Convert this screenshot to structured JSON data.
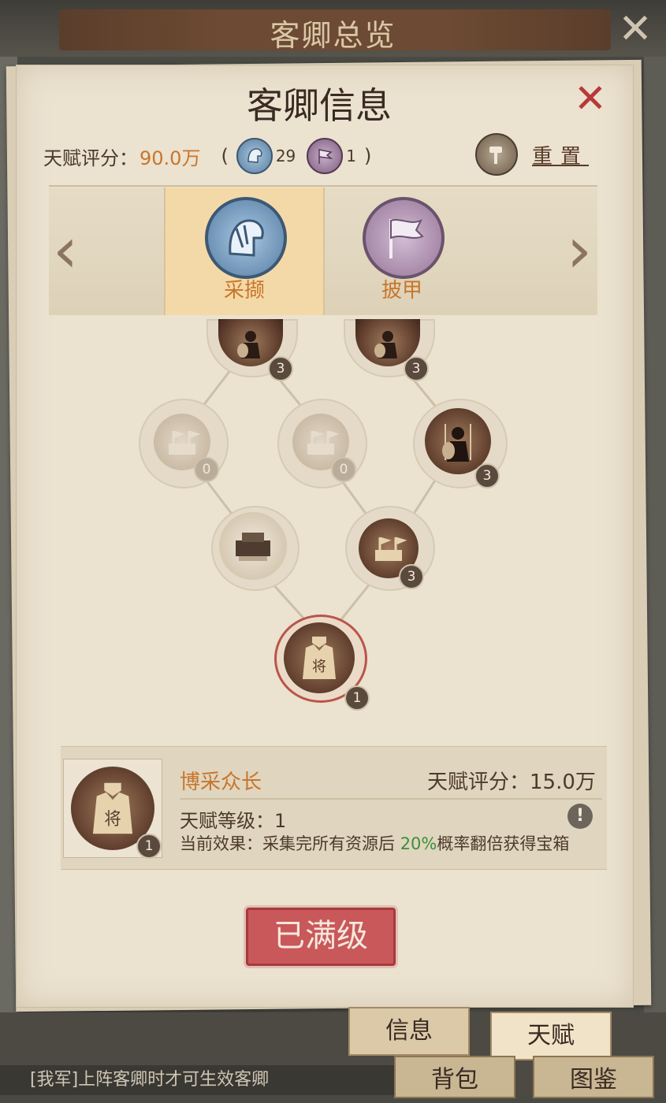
{
  "header": {
    "title": "客卿总览",
    "close_icon": "close-icon"
  },
  "panel": {
    "title": "客卿信息",
    "close_icon": "red-close-icon"
  },
  "summary": {
    "score_label": "天赋评分：",
    "score_value": "90.0万",
    "open_paren": "(",
    "close_paren": ")",
    "blue_count": "29",
    "purple_count": "1",
    "reset_label": "重置"
  },
  "categories": [
    {
      "label": "采撷",
      "icon": "helmet-icon",
      "active": true
    },
    {
      "label": "披甲",
      "icon": "flag-icon",
      "active": false
    }
  ],
  "tree": {
    "nodes": [
      {
        "icon": "soldiers-icon",
        "level": "3"
      },
      {
        "icon": "soldiers-icon",
        "level": "3"
      },
      {
        "icon": "flag-city-icon",
        "level": "0"
      },
      {
        "icon": "flag-city-icon",
        "level": "0"
      },
      {
        "icon": "soldiers-icon",
        "level": "3"
      },
      {
        "icon": "cart-icon",
        "level": ""
      },
      {
        "icon": "flag-city-icon",
        "level": "3"
      },
      {
        "icon": "general-robe-icon",
        "level": "1"
      }
    ]
  },
  "detail": {
    "name": "博采众长",
    "score": "天赋评分：15.0万",
    "level": "天赋等级：1",
    "effect_prefix": "当前效果：采集完所有资源后 ",
    "effect_highlight": "20%",
    "effect_suffix": "概率翻倍获得宝箱",
    "thumb_level": "1",
    "warn_symbol": "!"
  },
  "status": {
    "max_label": "已满级"
  },
  "tabs": [
    {
      "label": "信息",
      "active": false
    },
    {
      "label": "天赋",
      "active": true
    },
    {
      "label": "背包",
      "active": false
    },
    {
      "label": "图鉴",
      "active": false
    }
  ],
  "hint": "[我军]上阵客卿时才可生效客卿"
}
